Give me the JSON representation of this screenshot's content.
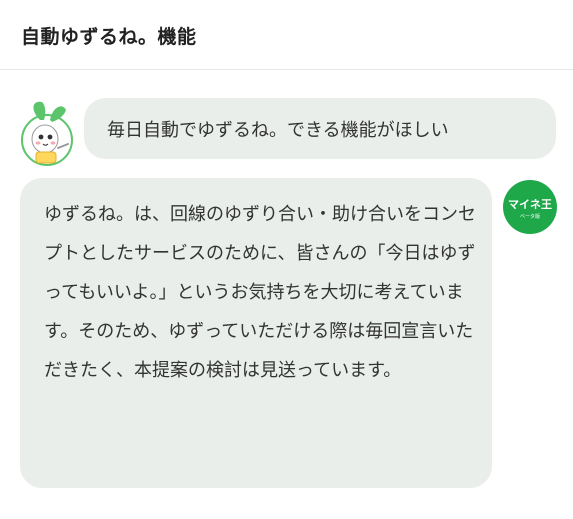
{
  "header": {
    "title": "自動ゆずるね。機能"
  },
  "conversation": {
    "user_message": "毎日自動でゆずるね。できる機能がほしい",
    "bot_message": "ゆずるね。は、回線のゆずり合い・助け合いをコンセプトとしたサービスのために、皆さんの「今日はゆずってもいいよ。」というお気持ちを大切に考えています。そのため、ゆずっていただける際は毎回宣言いただきたく、本提案の検討は見送っています。"
  },
  "bot_avatar": {
    "logo_text": "マイネ王",
    "logo_subtext": "ベータ版"
  },
  "colors": {
    "bubble_bg": "#e9eeea",
    "bot_green": "#1fa84a",
    "mascot_green": "#5cc46a"
  },
  "icons": {
    "user_avatar": "mascot-avatar-icon",
    "bot_avatar": "mineo-logo-icon"
  }
}
